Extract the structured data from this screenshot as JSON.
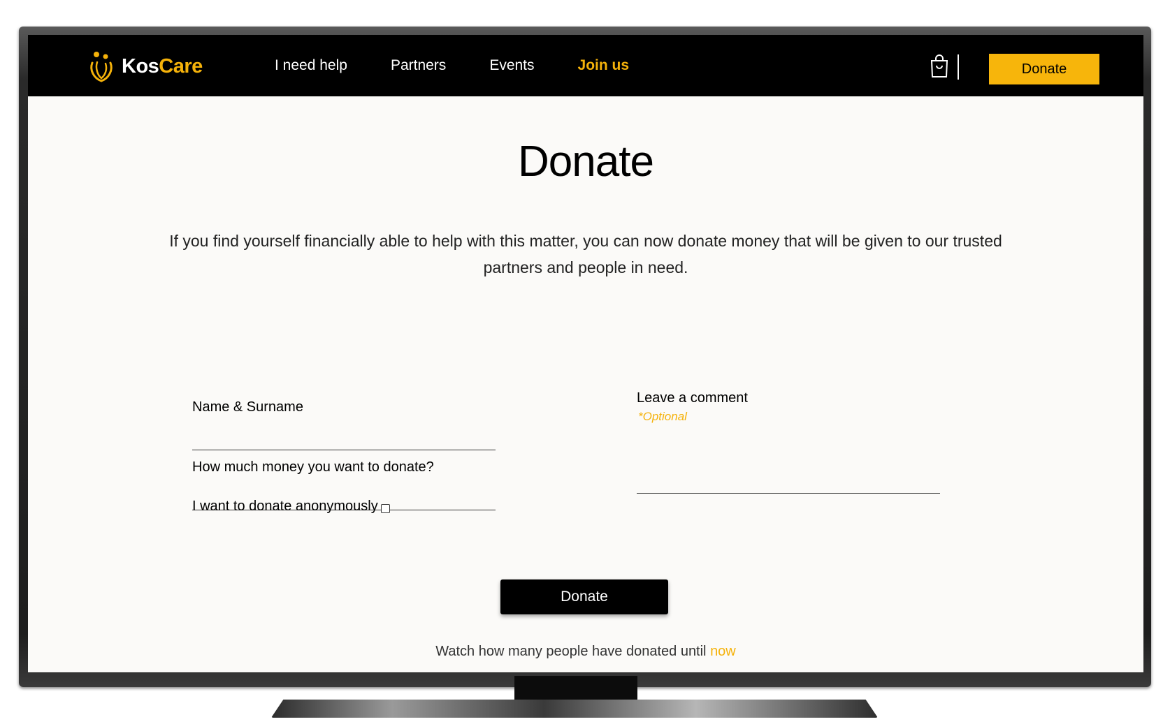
{
  "brand": {
    "name_part1": "Kos",
    "name_part2": "Care",
    "accent_color": "#f5b20a"
  },
  "nav": {
    "links": [
      {
        "label": "I need help"
      },
      {
        "label": "Partners"
      },
      {
        "label": "Events"
      },
      {
        "label": "Join us",
        "active": true
      }
    ],
    "cart_icon": "shopping-bag-icon",
    "donate_label": "Donate"
  },
  "main": {
    "title": "Donate",
    "intro": "If you find yourself financially able to help with this matter, you can now donate money that will be given to our trusted partners and people in need.",
    "form": {
      "name_label": "Name & Surname",
      "name_value": "",
      "amount_label": "How much money you want to donate?",
      "amount_value": "",
      "comment_label": "Leave a comment",
      "comment_optional": "*Optional",
      "comment_value": "",
      "anonymous_label": "I want to donate anonymously",
      "anonymous_checked": false,
      "submit_label": "Donate"
    },
    "footer": {
      "text": "Watch how many people have donated until ",
      "link": "now"
    }
  }
}
